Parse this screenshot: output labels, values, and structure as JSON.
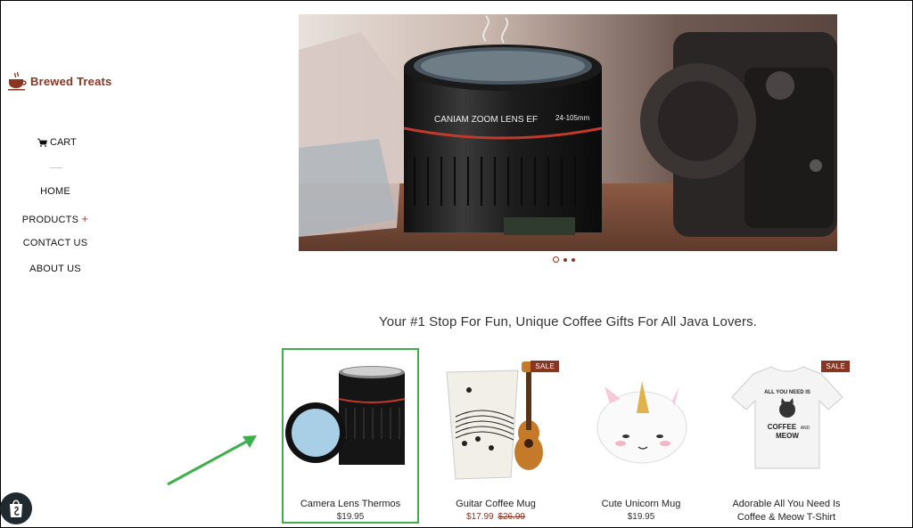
{
  "brand": {
    "name": "Brewed Treats",
    "color": "#8a3522"
  },
  "sidebar": {
    "cart_label": "CART",
    "nav": [
      {
        "label": "HOME"
      },
      {
        "label": "PRODUCTS",
        "expand": "+"
      },
      {
        "label": "CONTACT US"
      },
      {
        "label": "ABOUT US"
      }
    ]
  },
  "hero": {
    "lens_text": "CANIAM ZOOM LENS EF",
    "lens_range": "24-105mm",
    "slides": 3,
    "active_slide": 1
  },
  "tagline": "Your #1 Stop For Fun, Unique Coffee Gifts For All Java Lovers.",
  "products": [
    {
      "name": "Camera Lens Thermos",
      "price": "$19.95",
      "highlighted": true
    },
    {
      "name": "Guitar Coffee Mug",
      "sale_badge": "SALE",
      "price": "$17.99",
      "compare_price": "$26.99"
    },
    {
      "name": "Cute Unicorn Mug",
      "price": "$19.95"
    },
    {
      "name": "Adorable All You Need Is Coffee & Meow T-Shirt",
      "sale_badge": "SALE",
      "shirt_print": [
        "ALL YOU NEED IS",
        "COFFEE",
        "AND",
        "MEOW"
      ]
    }
  ],
  "colors": {
    "highlight": "#3cb04a",
    "sale": "#8a3522"
  }
}
